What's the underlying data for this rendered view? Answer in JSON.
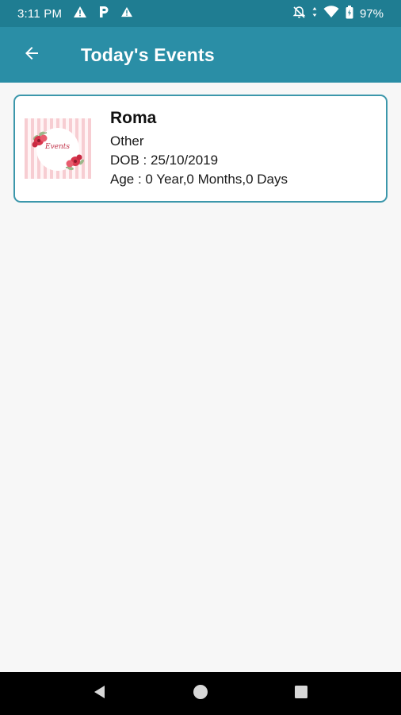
{
  "status_bar": {
    "time": "3:11 PM",
    "battery": "97%",
    "icons": [
      "warning-icon",
      "parking-icon",
      "warning-icon",
      "notifications-off-icon",
      "wifi-icon",
      "battery-icon"
    ]
  },
  "app_bar": {
    "back_icon": "arrow-back-icon",
    "title": "Today's Events"
  },
  "events": [
    {
      "name": "Roma",
      "type": "Other",
      "dob": "DOB : 25/10/2019",
      "age": "Age : 0 Year,0 Months,0 Days",
      "thumbnail_text": "Events"
    }
  ],
  "nav_bar": {
    "buttons": [
      "nav-back-icon",
      "nav-home-icon",
      "nav-recents-icon"
    ]
  },
  "colors": {
    "status_bar": "#1f7d92",
    "app_bar": "#2a8ea6",
    "card_border": "#3c97ab",
    "background": "#f7f7f7"
  }
}
